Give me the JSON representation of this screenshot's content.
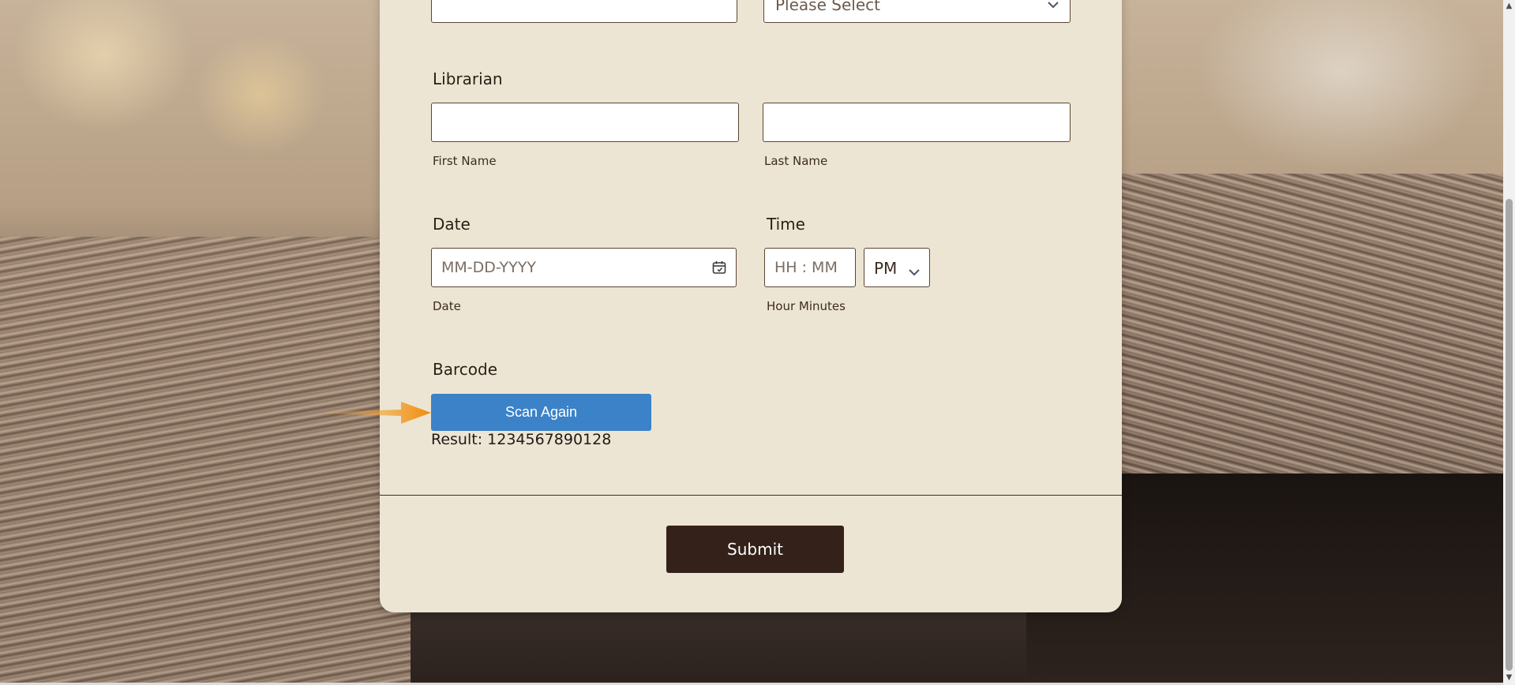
{
  "form": {
    "top_select": {
      "value": "Please Select"
    },
    "librarian": {
      "label": "Librarian",
      "first_name_label": "First Name",
      "last_name_label": "Last Name"
    },
    "date": {
      "label": "Date",
      "placeholder": "MM-DD-YYYY",
      "sublabel": "Date"
    },
    "time": {
      "label": "Time",
      "placeholder": "HH : MM",
      "ampm": "PM",
      "sublabel": "Hour Minutes"
    },
    "barcode": {
      "label": "Barcode",
      "scan_button": "Scan Again",
      "result": "Result: 1234567890128"
    },
    "submit_label": "Submit"
  },
  "icons": {
    "dropdown": "chevron-down-icon",
    "calendar": "calendar-icon",
    "pointer": "arrow-right-icon"
  },
  "colors": {
    "card_bg": "#ede5d3",
    "scan_button": "#3b82c8",
    "submit_button": "#33211a",
    "arrow": "#f39c12"
  }
}
